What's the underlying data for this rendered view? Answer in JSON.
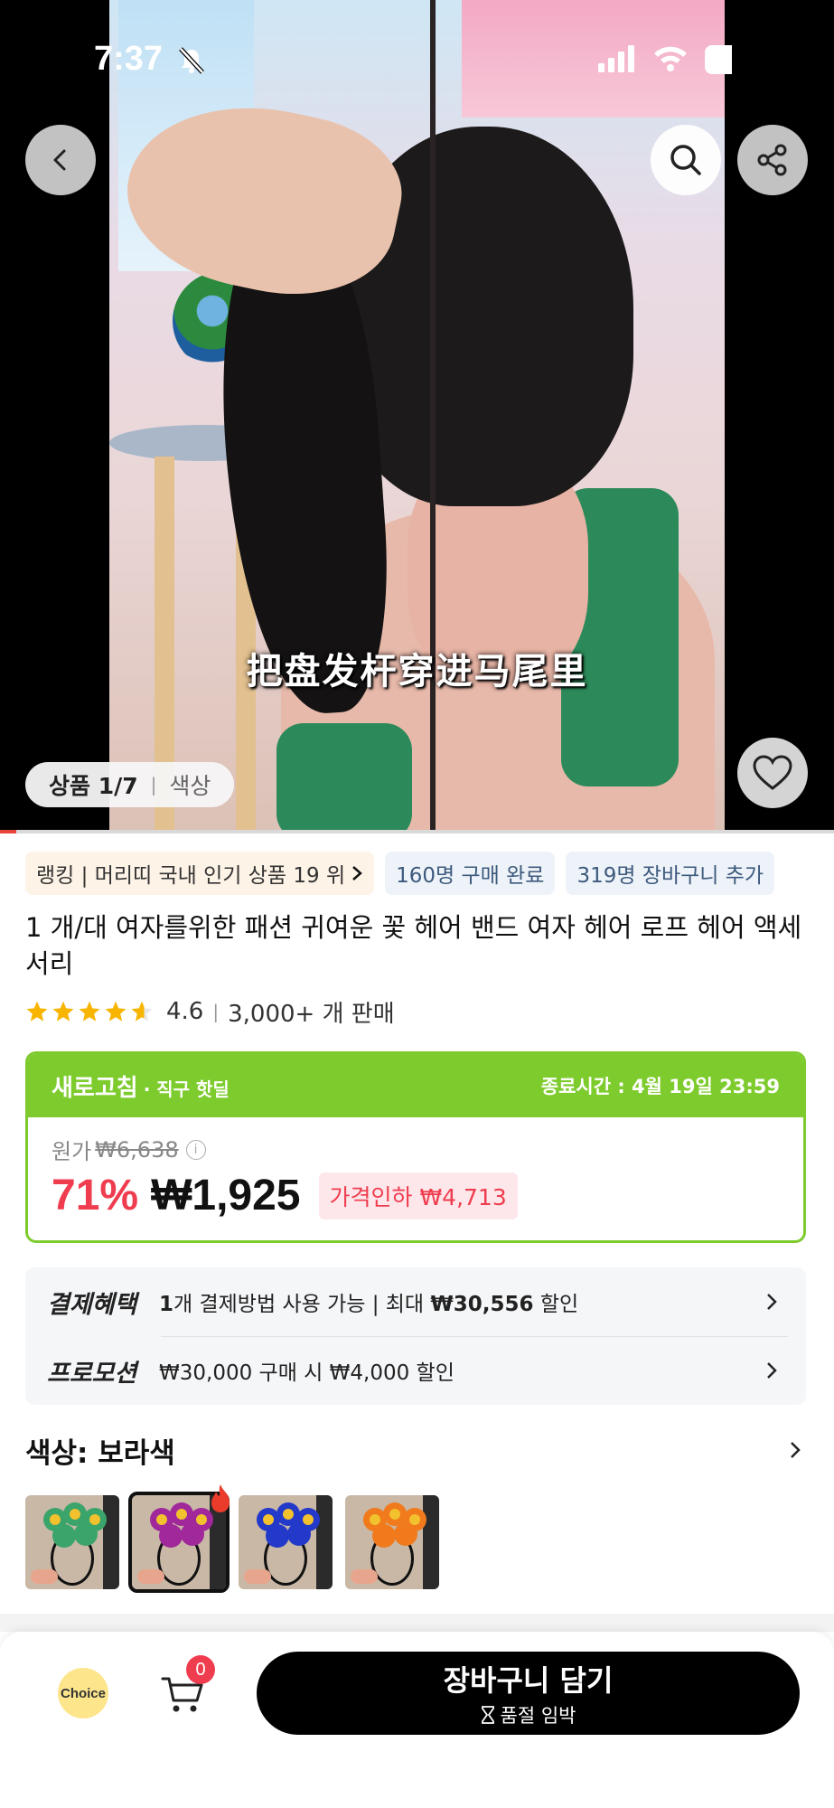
{
  "status_bar": {
    "time": "7:37"
  },
  "media": {
    "caption": "把盘发杆穿进马尾里",
    "pager_current": "상품 1/7",
    "pager_alt": "색상",
    "progress_fraction": 0.02
  },
  "chips": {
    "ranking": "랭킹 | 머리띠 국내 인기 상품 19 위",
    "purchased": "160명 구매 완료",
    "carted": "319명 장바구니 추가"
  },
  "product": {
    "title": "1 개/대 여자를위한 패션 귀여운 꽃 헤어 밴드 여자 헤어 로프 헤어 액세서리",
    "rating": "4.6",
    "rating_stars": 4.6,
    "sold": "3,000+ 개 판매"
  },
  "deal": {
    "brand": "새로고침",
    "brand_sub": "· 직구 핫딜",
    "ends": "종료시간 : 4월 19일 23:59",
    "original_label": "원가",
    "original_price": "₩6,638",
    "discount": "71%",
    "price": "₩1,925",
    "price_drop": "가격인하 ₩4,713",
    "colors": {
      "accent": "#7ecb2e",
      "discount": "#ef3d4f"
    }
  },
  "benefits": {
    "payment_label": "결제혜택",
    "payment_count": "1",
    "payment_text": "개 결제방법 사용 가능 | 최대 ",
    "payment_amount": "₩30,556",
    "payment_suffix": " 할인",
    "promo_label": "프로모션",
    "promo_text": "₩30,000 구매 시 ₩4,000 할인"
  },
  "color_option": {
    "label": "색상: 보라색",
    "swatches": [
      {
        "name": "green",
        "petal": "#3aa46a",
        "selected": false
      },
      {
        "name": "purple",
        "petal": "#a0289a",
        "selected": true
      },
      {
        "name": "blue",
        "petal": "#2239c9",
        "selected": false
      },
      {
        "name": "orange",
        "petal": "#f07a1c",
        "selected": false
      }
    ]
  },
  "bottom_bar": {
    "choice_label": "Choice",
    "cart_count": "0",
    "cta_main": "장바구니 담기",
    "cta_sub": "품절 임박"
  }
}
